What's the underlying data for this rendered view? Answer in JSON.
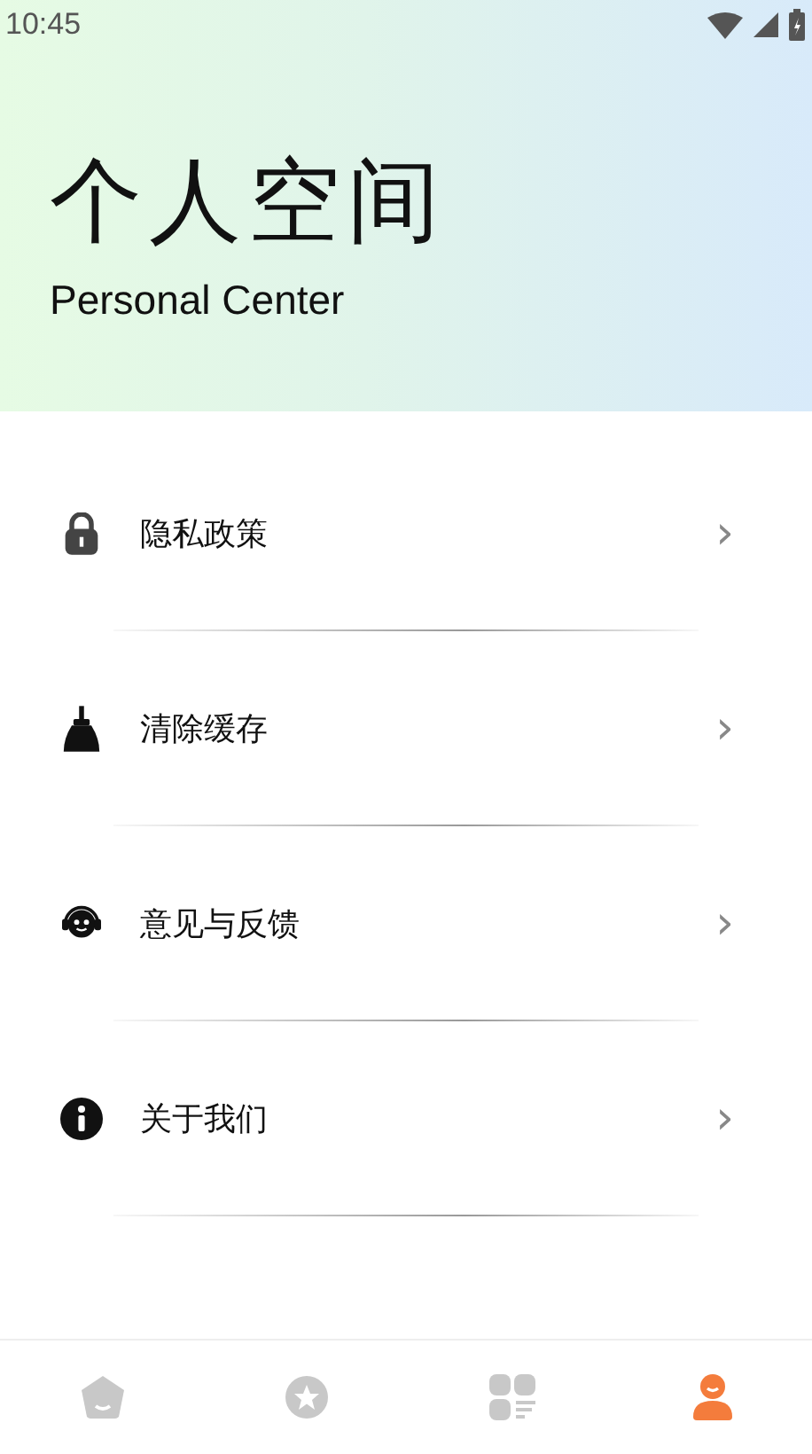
{
  "status_bar": {
    "time": "10:45"
  },
  "header": {
    "title": "个人空间",
    "subtitle": "Personal Center"
  },
  "menu": [
    {
      "label": "隐私政策",
      "chevron": "›"
    },
    {
      "label": "清除缓存",
      "chevron": "›"
    },
    {
      "label": "意见与反馈",
      "chevron": "›"
    },
    {
      "label": "关于我们",
      "chevron": "›"
    }
  ],
  "tab_bar": [
    {
      "selected": false
    },
    {
      "selected": false
    },
    {
      "selected": false
    },
    {
      "selected": true
    }
  ]
}
